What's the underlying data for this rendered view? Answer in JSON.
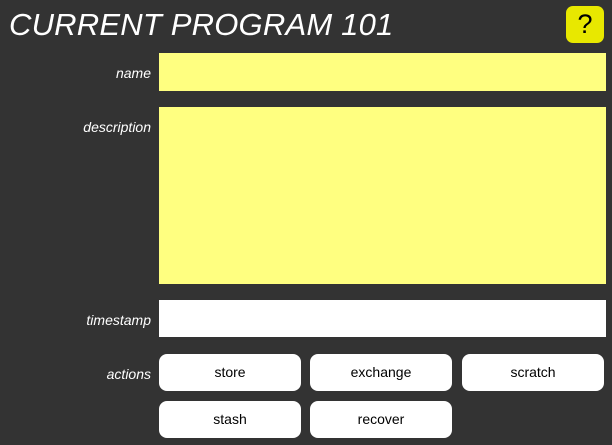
{
  "header": {
    "title": "CURRENT PROGRAM 101",
    "help_label": "?"
  },
  "form": {
    "name": {
      "label": "name",
      "value": ""
    },
    "description": {
      "label": "description",
      "value": ""
    },
    "timestamp": {
      "label": "timestamp",
      "value": ""
    }
  },
  "actions": {
    "label": "actions",
    "buttons": [
      "store",
      "exchange",
      "scratch",
      "stash",
      "recover"
    ]
  },
  "colors": {
    "background": "#333333",
    "field_yellow": "#ffff80",
    "help_button": "#e8e800",
    "button_bg": "#ffffff"
  }
}
